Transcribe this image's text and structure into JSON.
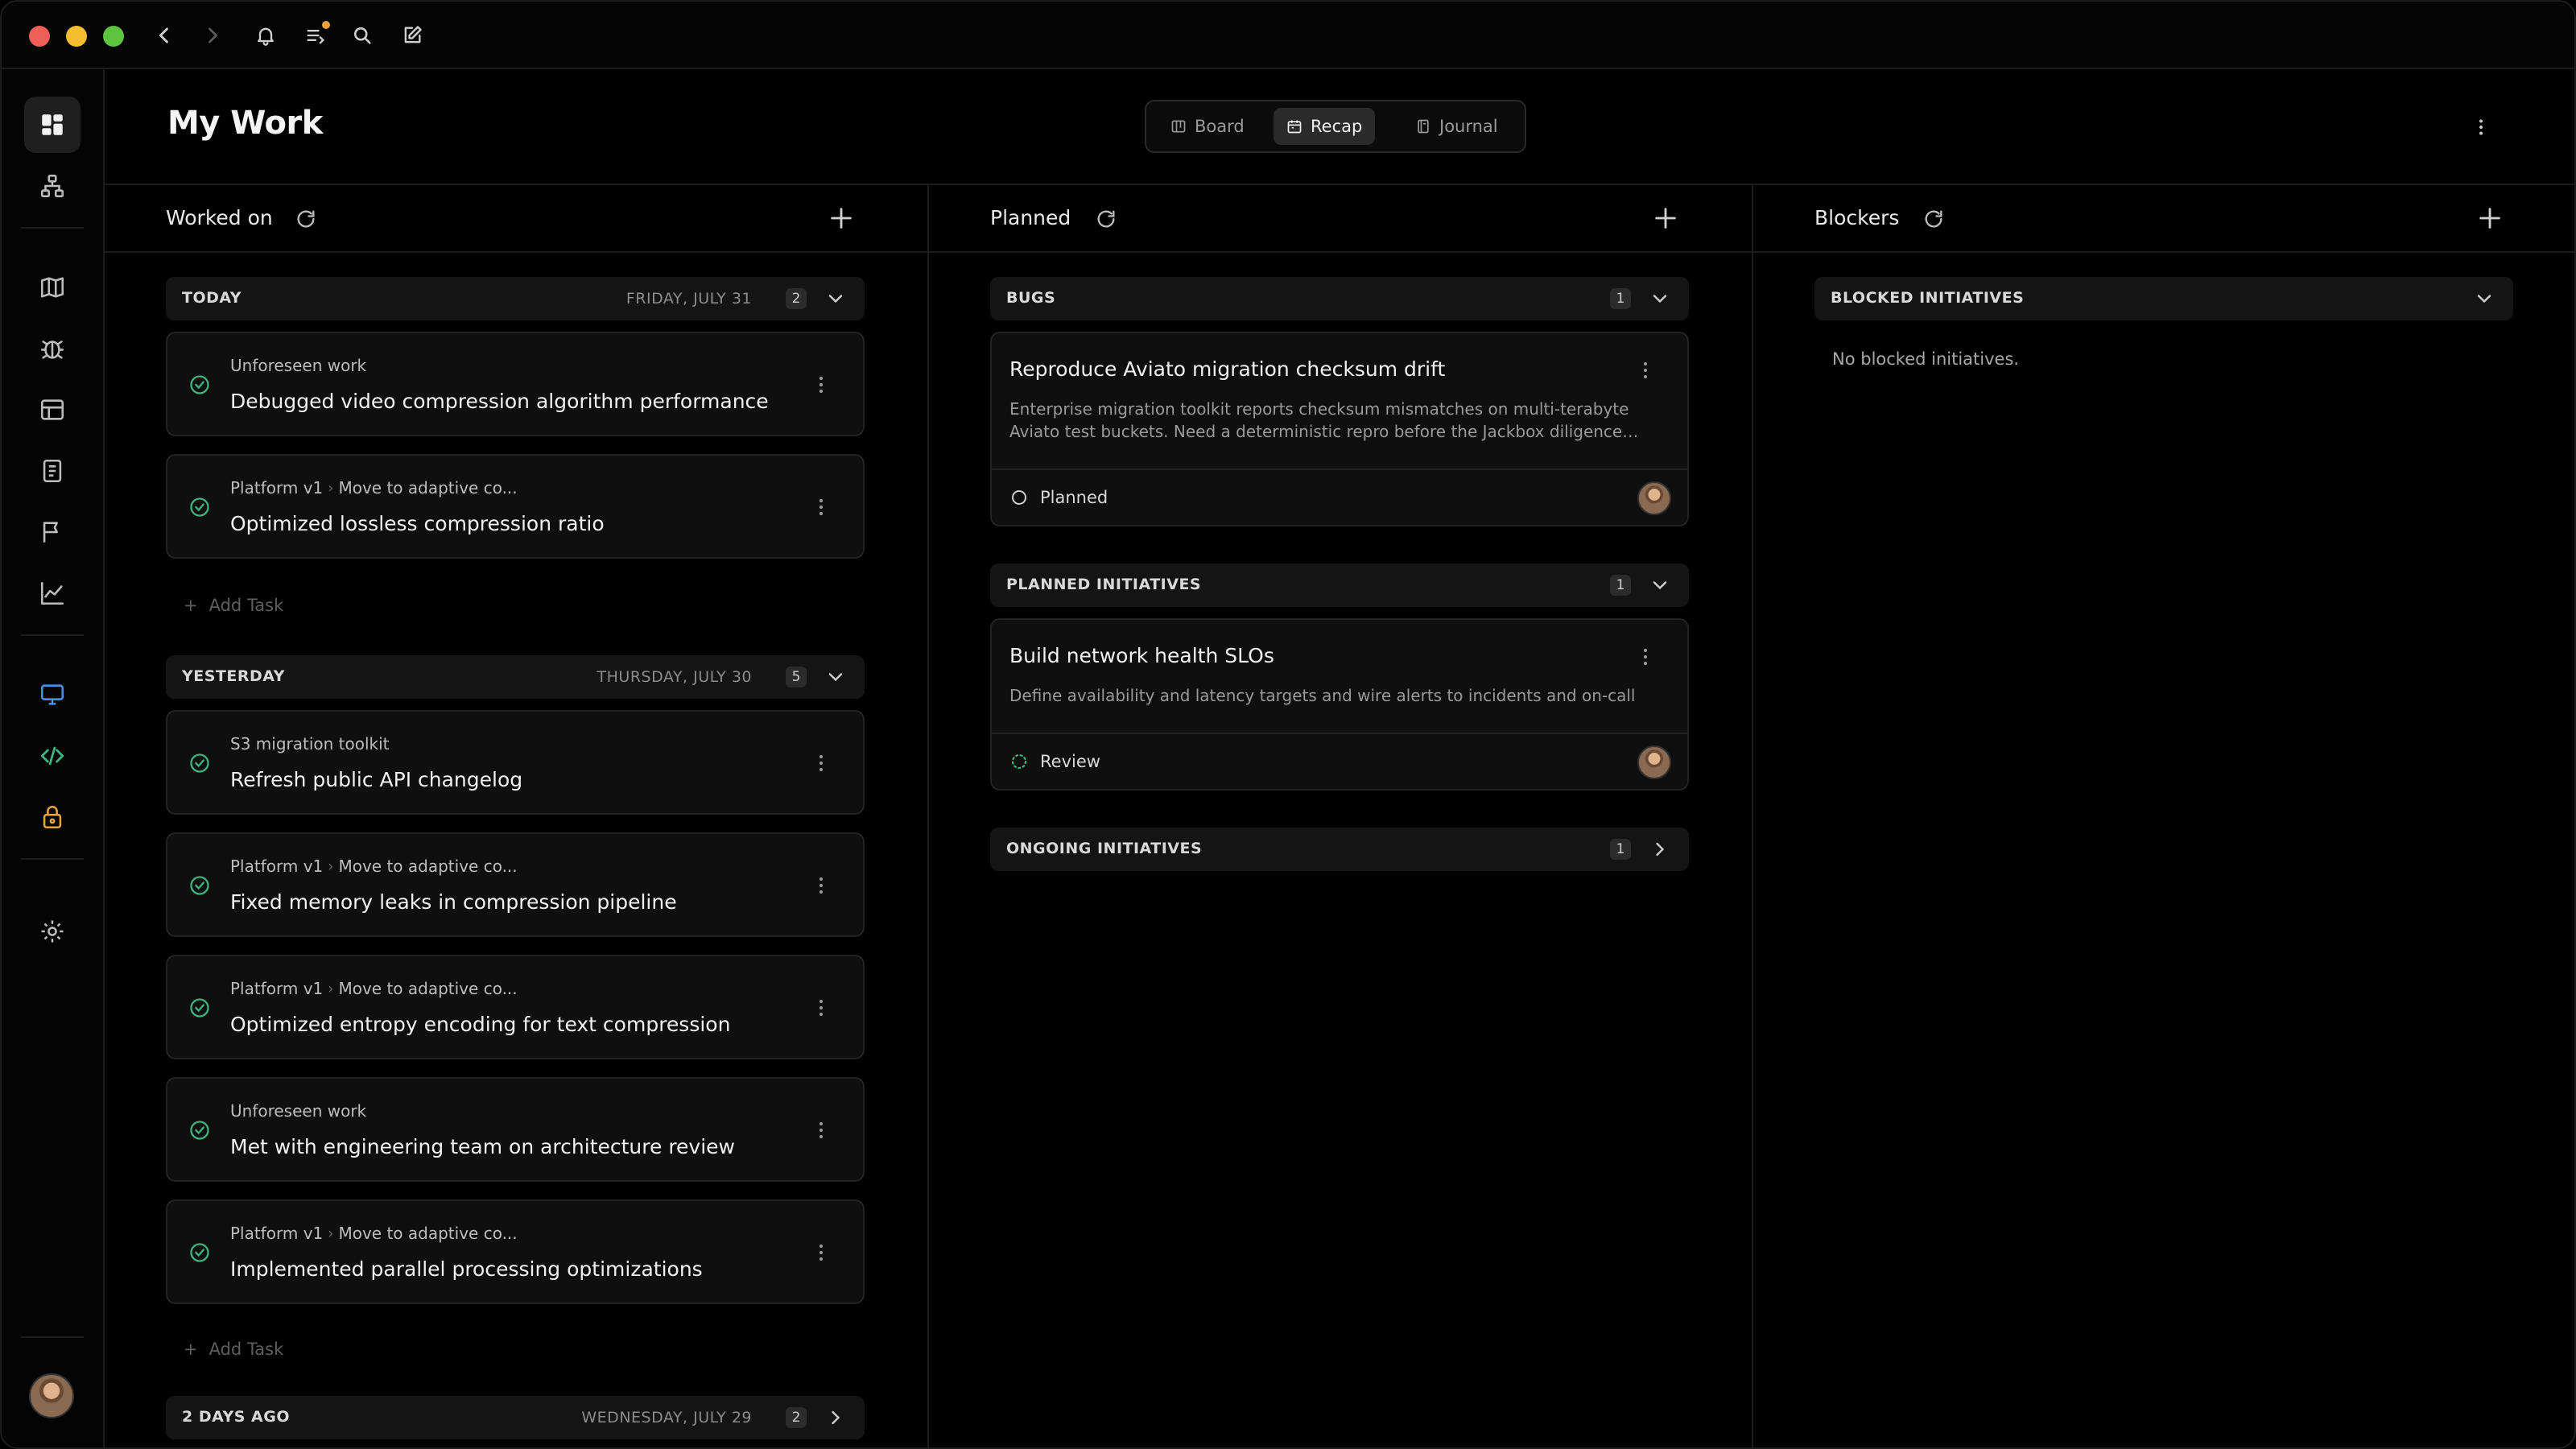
{
  "window": {
    "traffic_colors": [
      "#ed5f57",
      "#f4bd2f",
      "#5ec43f"
    ]
  },
  "titlebar": {
    "icons": [
      "chevron-left-icon",
      "chevron-right-icon",
      "bell-icon",
      "inbox-icon",
      "search-icon",
      "compose-icon"
    ]
  },
  "sidebar": {
    "items": [
      {
        "name": "sidebar-item-my-work",
        "icon": "dashboard-icon",
        "active": true
      },
      {
        "name": "sidebar-item-teams",
        "icon": "org-chart-icon"
      },
      {
        "name": "sidebar-item-roadmap",
        "icon": "map-icon"
      },
      {
        "name": "sidebar-item-bugs",
        "icon": "bug-icon"
      },
      {
        "name": "sidebar-item-releases",
        "icon": "layout-icon"
      },
      {
        "name": "sidebar-item-docs",
        "icon": "document-icon"
      },
      {
        "name": "sidebar-item-launches",
        "icon": "flag-icon"
      },
      {
        "name": "sidebar-item-insights",
        "icon": "chart-icon"
      },
      {
        "name": "sidebar-item-desktop",
        "icon": "monitor-icon"
      },
      {
        "name": "sidebar-item-code",
        "icon": "code-icon"
      },
      {
        "name": "sidebar-item-secrets",
        "icon": "lock-icon"
      },
      {
        "name": "sidebar-item-settings",
        "icon": "gear-icon"
      }
    ]
  },
  "header": {
    "title": "My Work",
    "views": [
      {
        "label": "Board",
        "icon": "board-icon"
      },
      {
        "label": "Recap",
        "icon": "calendar-icon",
        "active": true
      },
      {
        "label": "Journal",
        "icon": "journal-icon"
      }
    ]
  },
  "columns": {
    "worked_on": {
      "title": "Worked on",
      "groups": [
        {
          "label": "TODAY",
          "date": "FRIDAY, JULY 31",
          "count": "2",
          "tasks": [
            {
              "crumb": [
                "Unforeseen work"
              ],
              "title": "Debugged video compression algorithm performance"
            },
            {
              "crumb": [
                "Platform v1",
                "Move to adaptive co..."
              ],
              "title": "Optimized lossless compression ratio"
            }
          ],
          "add_label": "Add Task"
        },
        {
          "label": "YESTERDAY",
          "date": "THURSDAY, JULY 30",
          "count": "5",
          "tasks": [
            {
              "crumb": [
                "S3 migration toolkit"
              ],
              "title": "Refresh public API changelog"
            },
            {
              "crumb": [
                "Platform v1",
                "Move to adaptive co..."
              ],
              "title": "Fixed memory leaks in compression pipeline"
            },
            {
              "crumb": [
                "Platform v1",
                "Move to adaptive co..."
              ],
              "title": "Optimized entropy encoding for text compression"
            },
            {
              "crumb": [
                "Unforeseen work"
              ],
              "title": "Met with engineering team on architecture review"
            },
            {
              "crumb": [
                "Platform v1",
                "Move to adaptive co..."
              ],
              "title": "Implemented parallel processing optimizations"
            }
          ],
          "add_label": "Add Task"
        },
        {
          "label": "2 DAYS AGO",
          "date": "WEDNESDAY, JULY 29",
          "count": "2"
        }
      ]
    },
    "planned": {
      "title": "Planned",
      "bugs": {
        "label": "BUGS",
        "count": "1",
        "card": {
          "title": "Reproduce Aviato migration checksum drift",
          "desc": "Enterprise migration toolkit reports checksum mismatches on multi-terabyte Aviato test buckets. Need a deterministic repro before the Jackbox diligence…",
          "status": "Planned"
        }
      },
      "planned_initiatives": {
        "label": "PLANNED INITIATIVES",
        "count": "1",
        "card": {
          "title": "Build network health SLOs",
          "desc": "Define availability and latency targets and wire alerts to incidents and on-call",
          "status": "Review"
        }
      },
      "ongoing_initiatives": {
        "label": "ONGOING INITIATIVES",
        "count": "1"
      }
    },
    "blockers": {
      "title": "Blockers",
      "group_label": "BLOCKED INITIATIVES",
      "empty": "No blocked initiatives."
    }
  }
}
